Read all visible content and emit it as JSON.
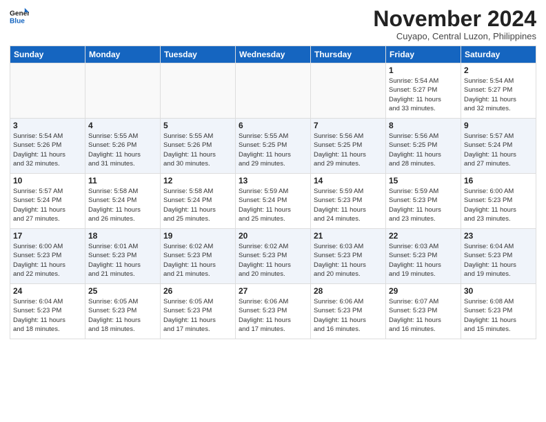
{
  "header": {
    "logo_general": "General",
    "logo_blue": "Blue",
    "month_title": "November 2024",
    "subtitle": "Cuyapo, Central Luzon, Philippines"
  },
  "days_of_week": [
    "Sunday",
    "Monday",
    "Tuesday",
    "Wednesday",
    "Thursday",
    "Friday",
    "Saturday"
  ],
  "weeks": [
    [
      {
        "num": "",
        "info": ""
      },
      {
        "num": "",
        "info": ""
      },
      {
        "num": "",
        "info": ""
      },
      {
        "num": "",
        "info": ""
      },
      {
        "num": "",
        "info": ""
      },
      {
        "num": "1",
        "info": "Sunrise: 5:54 AM\nSunset: 5:27 PM\nDaylight: 11 hours\nand 33 minutes."
      },
      {
        "num": "2",
        "info": "Sunrise: 5:54 AM\nSunset: 5:27 PM\nDaylight: 11 hours\nand 32 minutes."
      }
    ],
    [
      {
        "num": "3",
        "info": "Sunrise: 5:54 AM\nSunset: 5:26 PM\nDaylight: 11 hours\nand 32 minutes."
      },
      {
        "num": "4",
        "info": "Sunrise: 5:55 AM\nSunset: 5:26 PM\nDaylight: 11 hours\nand 31 minutes."
      },
      {
        "num": "5",
        "info": "Sunrise: 5:55 AM\nSunset: 5:26 PM\nDaylight: 11 hours\nand 30 minutes."
      },
      {
        "num": "6",
        "info": "Sunrise: 5:55 AM\nSunset: 5:25 PM\nDaylight: 11 hours\nand 29 minutes."
      },
      {
        "num": "7",
        "info": "Sunrise: 5:56 AM\nSunset: 5:25 PM\nDaylight: 11 hours\nand 29 minutes."
      },
      {
        "num": "8",
        "info": "Sunrise: 5:56 AM\nSunset: 5:25 PM\nDaylight: 11 hours\nand 28 minutes."
      },
      {
        "num": "9",
        "info": "Sunrise: 5:57 AM\nSunset: 5:24 PM\nDaylight: 11 hours\nand 27 minutes."
      }
    ],
    [
      {
        "num": "10",
        "info": "Sunrise: 5:57 AM\nSunset: 5:24 PM\nDaylight: 11 hours\nand 27 minutes."
      },
      {
        "num": "11",
        "info": "Sunrise: 5:58 AM\nSunset: 5:24 PM\nDaylight: 11 hours\nand 26 minutes."
      },
      {
        "num": "12",
        "info": "Sunrise: 5:58 AM\nSunset: 5:24 PM\nDaylight: 11 hours\nand 25 minutes."
      },
      {
        "num": "13",
        "info": "Sunrise: 5:59 AM\nSunset: 5:24 PM\nDaylight: 11 hours\nand 25 minutes."
      },
      {
        "num": "14",
        "info": "Sunrise: 5:59 AM\nSunset: 5:23 PM\nDaylight: 11 hours\nand 24 minutes."
      },
      {
        "num": "15",
        "info": "Sunrise: 5:59 AM\nSunset: 5:23 PM\nDaylight: 11 hours\nand 23 minutes."
      },
      {
        "num": "16",
        "info": "Sunrise: 6:00 AM\nSunset: 5:23 PM\nDaylight: 11 hours\nand 23 minutes."
      }
    ],
    [
      {
        "num": "17",
        "info": "Sunrise: 6:00 AM\nSunset: 5:23 PM\nDaylight: 11 hours\nand 22 minutes."
      },
      {
        "num": "18",
        "info": "Sunrise: 6:01 AM\nSunset: 5:23 PM\nDaylight: 11 hours\nand 21 minutes."
      },
      {
        "num": "19",
        "info": "Sunrise: 6:02 AM\nSunset: 5:23 PM\nDaylight: 11 hours\nand 21 minutes."
      },
      {
        "num": "20",
        "info": "Sunrise: 6:02 AM\nSunset: 5:23 PM\nDaylight: 11 hours\nand 20 minutes."
      },
      {
        "num": "21",
        "info": "Sunrise: 6:03 AM\nSunset: 5:23 PM\nDaylight: 11 hours\nand 20 minutes."
      },
      {
        "num": "22",
        "info": "Sunrise: 6:03 AM\nSunset: 5:23 PM\nDaylight: 11 hours\nand 19 minutes."
      },
      {
        "num": "23",
        "info": "Sunrise: 6:04 AM\nSunset: 5:23 PM\nDaylight: 11 hours\nand 19 minutes."
      }
    ],
    [
      {
        "num": "24",
        "info": "Sunrise: 6:04 AM\nSunset: 5:23 PM\nDaylight: 11 hours\nand 18 minutes."
      },
      {
        "num": "25",
        "info": "Sunrise: 6:05 AM\nSunset: 5:23 PM\nDaylight: 11 hours\nand 18 minutes."
      },
      {
        "num": "26",
        "info": "Sunrise: 6:05 AM\nSunset: 5:23 PM\nDaylight: 11 hours\nand 17 minutes."
      },
      {
        "num": "27",
        "info": "Sunrise: 6:06 AM\nSunset: 5:23 PM\nDaylight: 11 hours\nand 17 minutes."
      },
      {
        "num": "28",
        "info": "Sunrise: 6:06 AM\nSunset: 5:23 PM\nDaylight: 11 hours\nand 16 minutes."
      },
      {
        "num": "29",
        "info": "Sunrise: 6:07 AM\nSunset: 5:23 PM\nDaylight: 11 hours\nand 16 minutes."
      },
      {
        "num": "30",
        "info": "Sunrise: 6:08 AM\nSunset: 5:23 PM\nDaylight: 11 hours\nand 15 minutes."
      }
    ]
  ]
}
